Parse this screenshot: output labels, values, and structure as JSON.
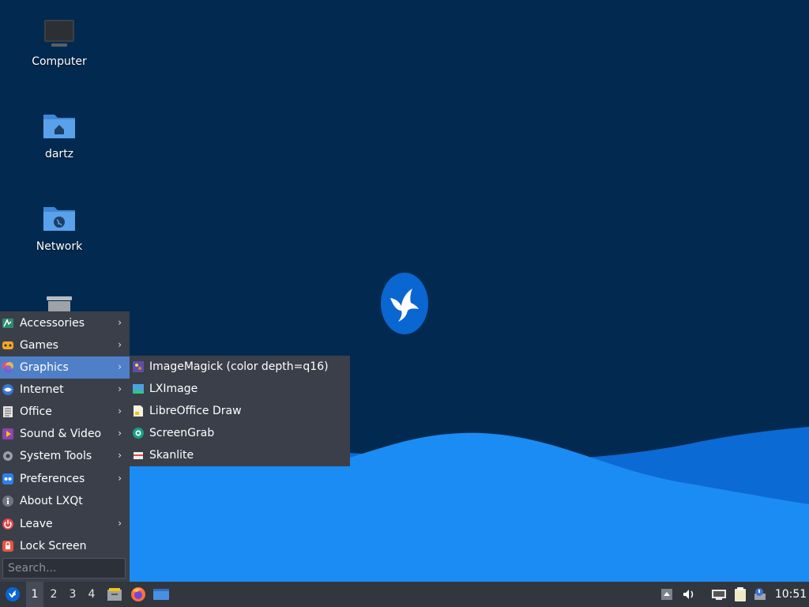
{
  "desktop": {
    "icons": [
      {
        "label": "Computer",
        "icon": "computer-icon"
      },
      {
        "label": "dartz",
        "icon": "home-folder-icon"
      },
      {
        "label": "Network",
        "icon": "network-folder-icon"
      },
      {
        "label": "",
        "icon": "trash-icon"
      }
    ],
    "background_colors": {
      "sky": "#022a50",
      "wave_light": "#1a8af0",
      "wave_dark": "#0a64d2"
    },
    "logo": "lubuntu-bird-logo"
  },
  "main_menu": {
    "items": [
      {
        "label": "Accessories",
        "icon": "accessories-icon",
        "submenu": true
      },
      {
        "label": "Games",
        "icon": "games-icon",
        "submenu": true
      },
      {
        "label": "Graphics",
        "icon": "graphics-icon",
        "submenu": true,
        "active": true
      },
      {
        "label": "Internet",
        "icon": "internet-icon",
        "submenu": true
      },
      {
        "label": "Office",
        "icon": "office-icon",
        "submenu": true
      },
      {
        "label": "Sound & Video",
        "icon": "sound-video-icon",
        "submenu": true
      },
      {
        "label": "System Tools",
        "icon": "system-tools-icon",
        "submenu": true
      },
      {
        "label": "Preferences",
        "icon": "preferences-icon",
        "submenu": true
      },
      {
        "label": "About LXQt",
        "icon": "about-icon",
        "submenu": false
      },
      {
        "label": "Leave",
        "icon": "leave-icon",
        "submenu": true
      },
      {
        "label": "Lock Screen",
        "icon": "lock-icon",
        "submenu": false
      }
    ],
    "search_placeholder": "Search...",
    "arrow": "›"
  },
  "graphics_submenu": {
    "items": [
      {
        "label": "ImageMagick (color depth=q16)",
        "icon": "imagemagick-icon"
      },
      {
        "label": "LXImage",
        "icon": "lximage-icon"
      },
      {
        "label": "LibreOffice Draw",
        "icon": "libreoffice-draw-icon"
      },
      {
        "label": "ScreenGrab",
        "icon": "screengrab-icon"
      },
      {
        "label": "Skanlite",
        "icon": "skanlite-icon"
      }
    ]
  },
  "taskbar": {
    "start_icon": "lubuntu-start-icon",
    "desktops": [
      "1",
      "2",
      "3",
      "4"
    ],
    "active_desktop": "1",
    "quicklaunch": [
      "file-manager-icon",
      "firefox-icon",
      "show-desktop-icon"
    ],
    "tray": [
      "tray-up-icon",
      "volume-icon",
      "network-icon",
      "clipboard-icon",
      "update-notifier-icon"
    ],
    "clock": "10:51"
  }
}
